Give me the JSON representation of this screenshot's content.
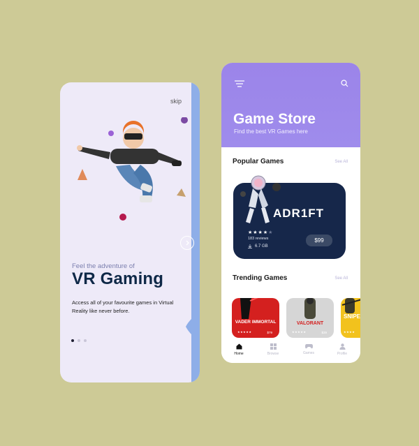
{
  "onboarding": {
    "skip_label": "skip",
    "tagline": "Feel the adventure of",
    "headline": "VR Gaming",
    "description": "Access all of your favourite games in Virtual Reality like never before.",
    "pagination": {
      "total": 3,
      "active": 0
    }
  },
  "store": {
    "title": "Game Store",
    "subtitle": "Find the best VR Games here",
    "popular": {
      "heading": "Popular Games",
      "see_all": "See All",
      "featured": {
        "name": "ADR1FT",
        "rating": 4,
        "rating_max": 5,
        "reviews": "183 reviews",
        "size": "6.7 GB",
        "price": "$99"
      }
    },
    "trending": {
      "heading": "Trending Games",
      "see_all": "See All",
      "games": [
        {
          "name": "VADER IMMORTAL",
          "price": "$79",
          "color": "#d4201f"
        },
        {
          "name": "VALORANT",
          "price": "$39",
          "color": "#d6d6d6"
        },
        {
          "name": "SNIPE",
          "price": "",
          "color": "#f2c21d"
        }
      ]
    },
    "nav": [
      {
        "label": "Home",
        "icon": "home-icon",
        "active": true
      },
      {
        "label": "Browse",
        "icon": "grid-icon",
        "active": false
      },
      {
        "label": "Games",
        "icon": "gamepad-icon",
        "active": false
      },
      {
        "label": "Profile",
        "icon": "profile-icon",
        "active": false
      }
    ]
  },
  "colors": {
    "background": "#cdca96",
    "store_header": "#9b84e9",
    "onboarding_bg": "#eeeaf8",
    "onboarding_accent": "#8eaee8",
    "headline": "#0e2847",
    "feature_card": "#16274a"
  }
}
